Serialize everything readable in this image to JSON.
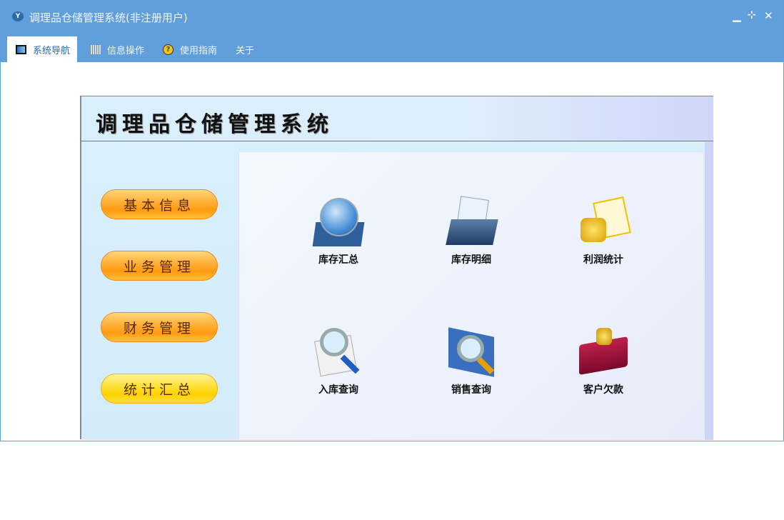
{
  "window": {
    "title": "调理品仓储管理系统(非注册用户)",
    "logo": "Y",
    "controls": [
      "minimize-icon",
      "restore-icon",
      "close-icon"
    ]
  },
  "tabs": [
    {
      "label": "系统导航",
      "icon": "monitor-icon"
    },
    {
      "label": "信息操作",
      "icon": "grid-icon"
    },
    {
      "label": "使用指南",
      "icon": "help-icon"
    },
    {
      "label": "关于"
    }
  ],
  "app": {
    "header": "调理品仓储管理系统",
    "nav_buttons": [
      "基本信息",
      "业务管理",
      "财务管理",
      "统计汇总"
    ],
    "features": [
      {
        "label": "库存汇总",
        "icon": "globe-icon"
      },
      {
        "label": "库存明细",
        "icon": "folder-icon"
      },
      {
        "label": "利润统计",
        "icon": "coins-icon"
      },
      {
        "label": "入库查询",
        "icon": "magnifier-icon"
      },
      {
        "label": "销售查询",
        "icon": "book-search-icon"
      },
      {
        "label": "客户欠款",
        "icon": "red-book-icon"
      }
    ]
  }
}
